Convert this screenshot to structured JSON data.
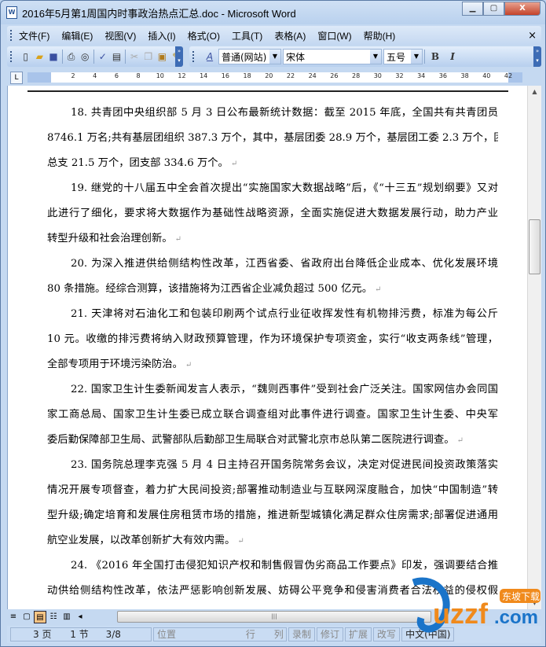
{
  "window": {
    "title": "2016年5月第1周国内时事政治热点汇总.doc - Microsoft Word",
    "app_icon": "W",
    "minimize": "▁",
    "maximize": "▢",
    "close": "X"
  },
  "menu": [
    "文件(F)",
    "编辑(E)",
    "视图(V)",
    "插入(I)",
    "格式(O)",
    "工具(T)",
    "表格(A)",
    "窗口(W)",
    "帮助(H)"
  ],
  "menu_close": "×",
  "format": {
    "style": "普通(网站)",
    "font": "宋体",
    "size": "五号",
    "bold": "B",
    "italic": "I"
  },
  "ruler": {
    "ticks": [
      "2",
      "4",
      "6",
      "8",
      "10",
      "12",
      "14",
      "16",
      "18",
      "20",
      "22",
      "24",
      "26",
      "28",
      "30",
      "32",
      "34",
      "36",
      "38",
      "40",
      "42"
    ],
    "tab_box": "L"
  },
  "paragraphs": [
    {
      "lines": [
        "18. 共青团中央组织部 5 月 3 日公布最新统计数据：截至 2015 年底，全国共有共青团员",
        "8746.1 万名;共有基层团组织 387.3 万个，其中，基层团委 28.9 万个，基层团工委 2.3 万个，团",
        "总支 21.5 万个，团支部 334.6 万个。"
      ]
    },
    {
      "lines": [
        "19. 继党的十八届五中全会首次提出“实施国家大数据战略”后，《“十三五”规划纲要》又对",
        "此进行了细化，要求将大数据作为基础性战略资源，全面实施促进大数据发展行动，助力产业",
        "转型升级和社会治理创新。"
      ]
    },
    {
      "lines": [
        "20. 为深入推进供给侧结构性改革，江西省委、省政府出台降低企业成本、优化发展环境",
        "80 条措施。经综合测算，该措施将为江西省企业减负超过 500 亿元。"
      ]
    },
    {
      "lines": [
        "21. 天津将对石油化工和包装印刷两个试点行业征收挥发性有机物排污费，标准为每公斤",
        "10 元。收缴的排污费将纳入财政预算管理，作为环境保护专项资金，实行“收支两条线”管理，",
        "全部专项用于环境污染防治。"
      ]
    },
    {
      "lines": [
        "22. 国家卫生计生委新闻发言人表示，“魏则西事件”受到社会广泛关注。国家网信办会同国",
        "家工商总局、国家卫生计生委已成立联合调查组对此事件进行调查。国家卫生计生委、中央军",
        "委后勤保障部卫生局、武警部队后勤部卫生局联合对武警北京市总队第二医院进行调查。"
      ]
    },
    {
      "lines": [
        "23. 国务院总理李克强 5 月 4 日主持召开国务院常务会议，决定对促进民间投资政策落实",
        "情况开展专项督查，着力扩大民间投资;部署推动制造业与互联网深度融合，加快“中国制造”转",
        "型升级;确定培育和发展住房租赁市场的措施，推进新型城镇化满足群众住房需求;部署促进通用",
        "航空业发展，以改革创新扩大有效内需。"
      ]
    },
    {
      "lines": [
        "24. 《2016 年全国打击侵犯知识产权和制售假冒伪劣商品工作要点》印发，强调要结合推",
        "动供给侧结构性改革，依法严惩影响创新发展、妨碍公平竞争和侵害消费者合法权益的侵权假"
      ]
    }
  ],
  "paragraph_mark": "↵",
  "status": {
    "page": "3 页",
    "section": "1 节",
    "page_of": "3/8",
    "position": "位置",
    "line": "行",
    "column": "列",
    "rec": "录制",
    "trk": "修订",
    "ext": "扩展",
    "ovr": "改写",
    "lang": "中文(中国)"
  },
  "watermark": {
    "text": "uzzf.com",
    "badge": "东坡下载"
  }
}
